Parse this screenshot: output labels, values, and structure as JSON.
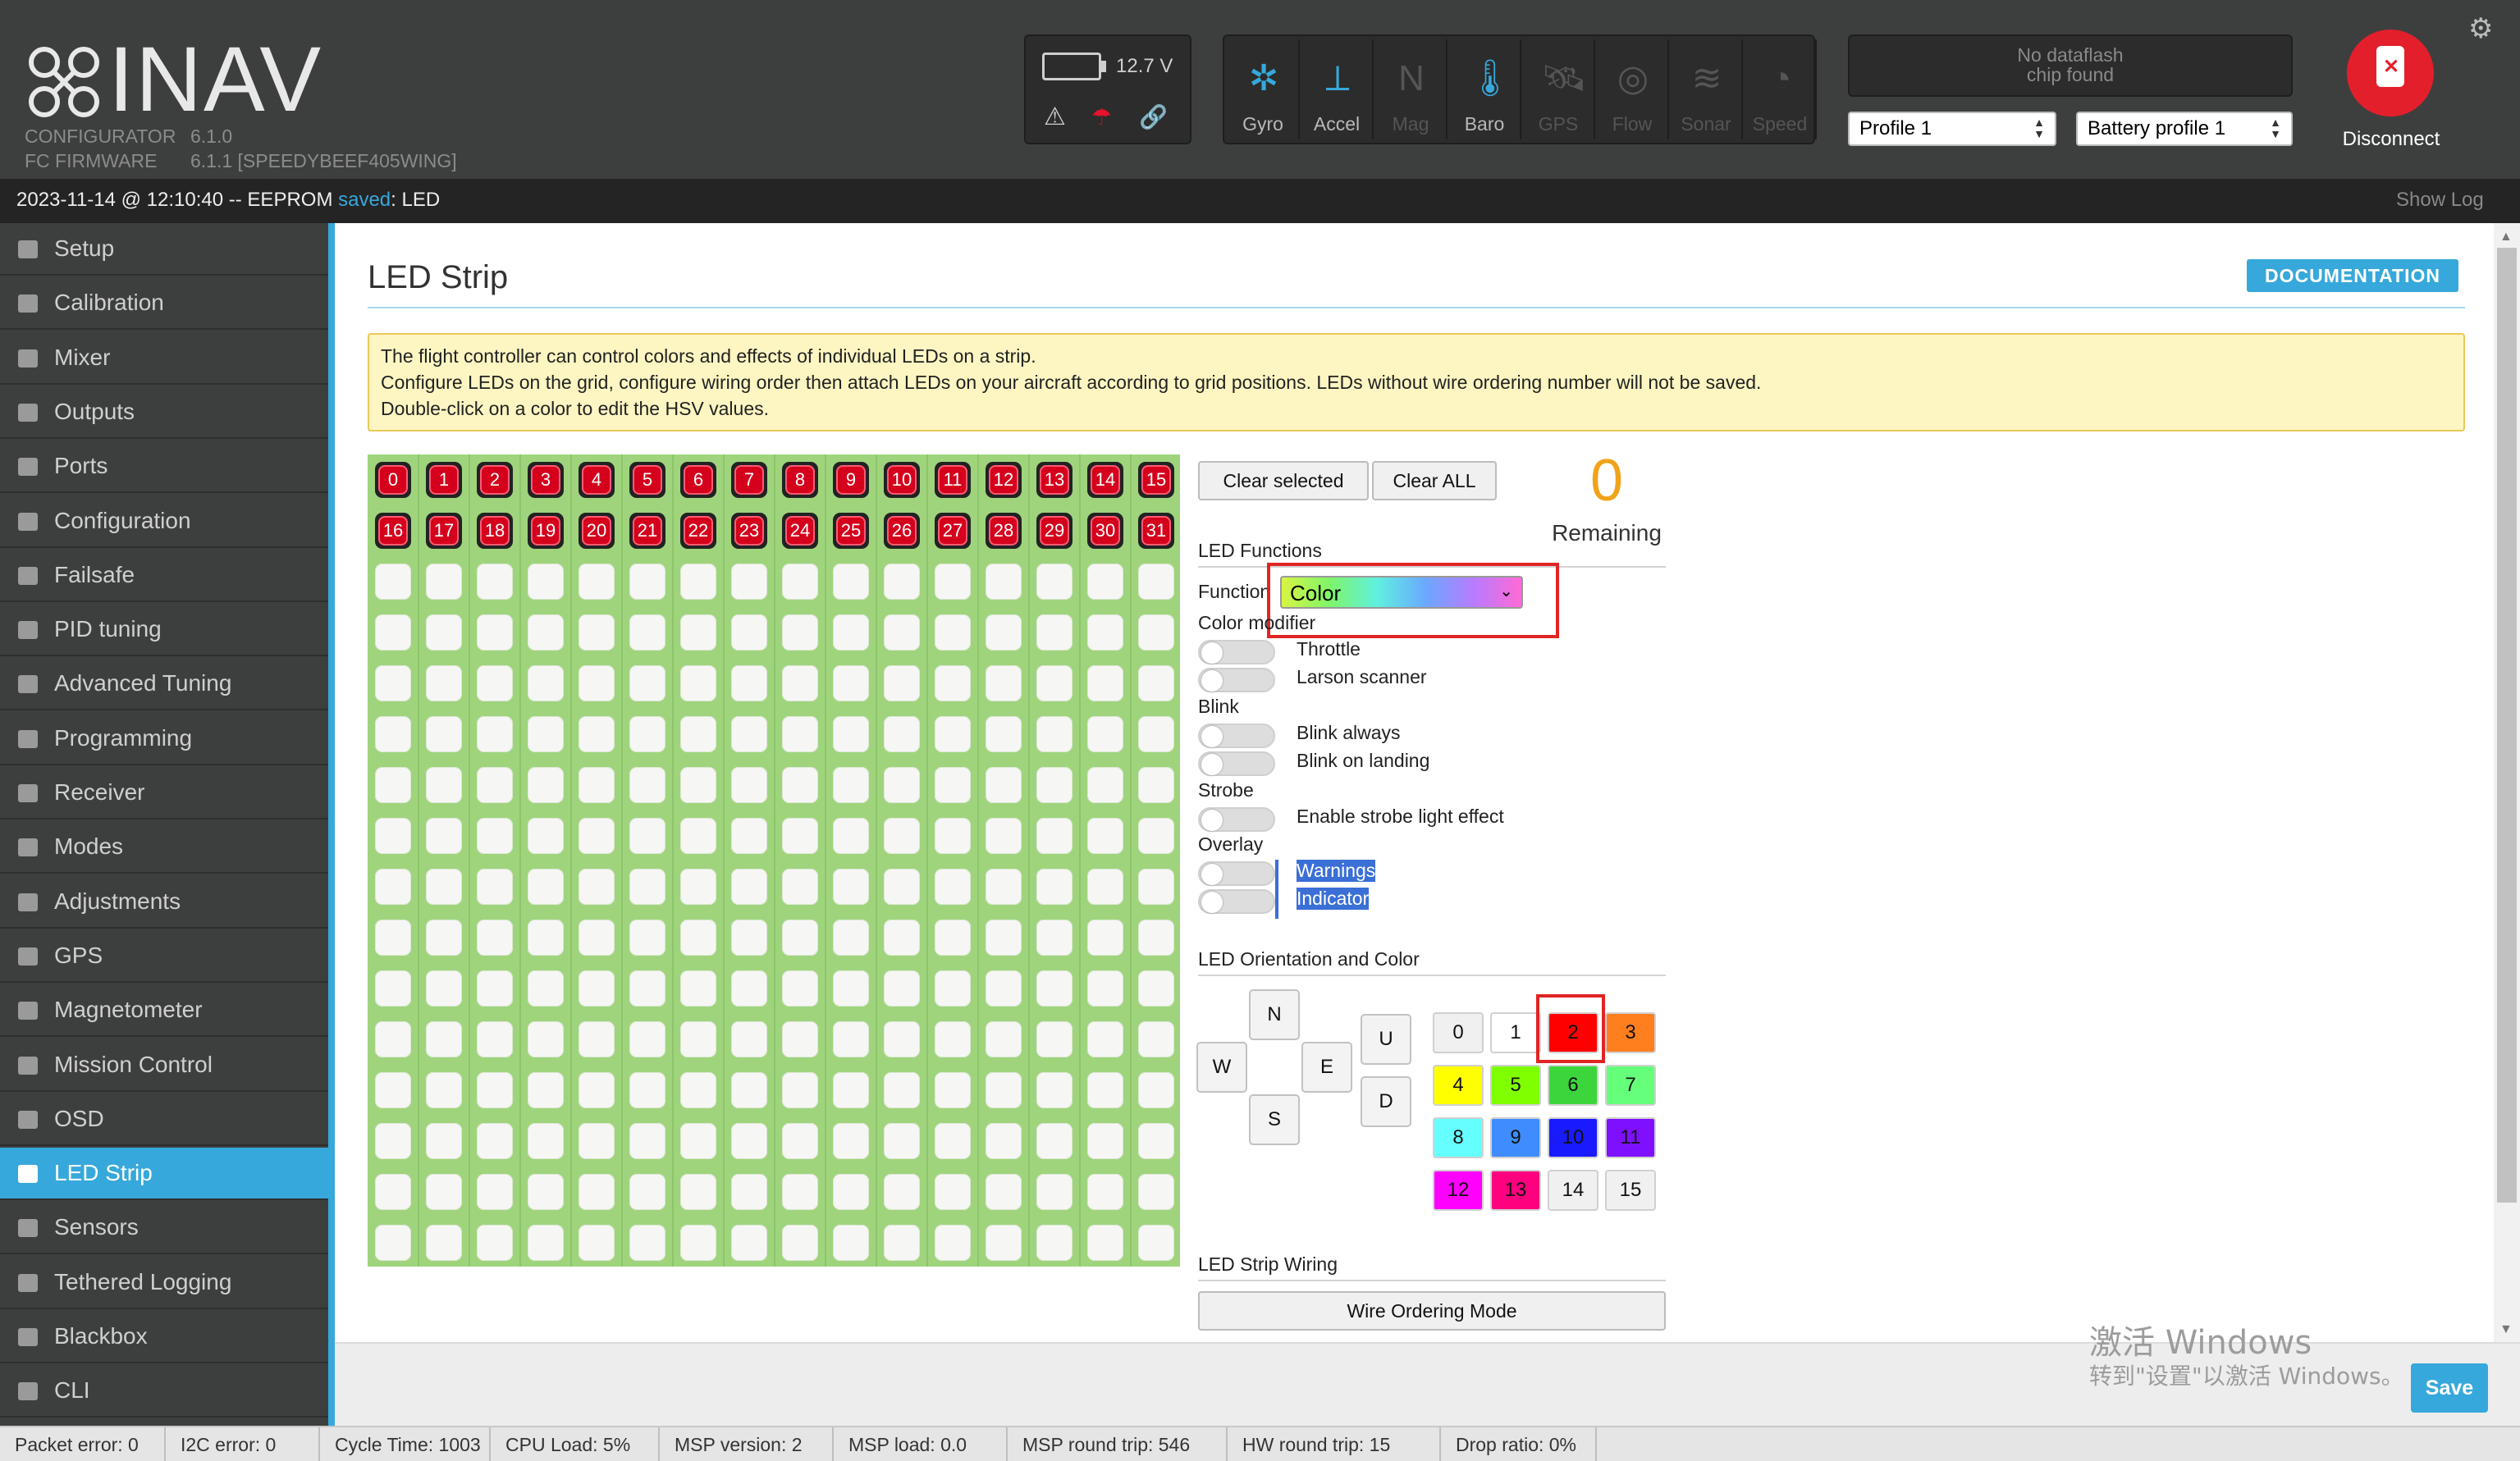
{
  "app": {
    "logo_text": "INAV",
    "configurator_label": "CONFIGURATOR",
    "configurator_version": "6.1.0",
    "fc_label": "FC FIRMWARE",
    "fc_version": "6.1.1 [SPEEDYBEEF405WING]"
  },
  "battery": {
    "voltage": "12.7 V"
  },
  "sensors": [
    {
      "label": "Gyro",
      "active": true,
      "icon": "gyro-icon"
    },
    {
      "label": "Accel",
      "active": true,
      "icon": "accel-icon"
    },
    {
      "label": "Mag",
      "active": false,
      "icon": "mag-icon"
    },
    {
      "label": "Baro",
      "active": true,
      "icon": "baro-icon"
    },
    {
      "label": "GPS",
      "active": false,
      "icon": "gps-icon"
    },
    {
      "label": "Flow",
      "active": false,
      "icon": "flow-icon"
    },
    {
      "label": "Sonar",
      "active": false,
      "icon": "sonar-icon"
    },
    {
      "label": "Speed",
      "active": false,
      "icon": "speed-icon"
    }
  ],
  "dataflash": {
    "line1": "No dataflash",
    "line2": "chip found"
  },
  "profile": {
    "selected": "Profile 1"
  },
  "battery_profile": {
    "selected": "Battery profile 1"
  },
  "disconnect": {
    "label": "Disconnect"
  },
  "statusbar": {
    "prefix": "2023-11-14 @ 12:10:40 -- EEPROM ",
    "saved": "saved",
    "suffix": ": LED",
    "show_log": "Show Log"
  },
  "sidebar": {
    "items": [
      {
        "label": "Setup",
        "icon": "wrench-icon"
      },
      {
        "label": "Calibration",
        "icon": "crosshair-icon"
      },
      {
        "label": "Mixer",
        "icon": "mixer-icon"
      },
      {
        "label": "Outputs",
        "icon": "motor-icon"
      },
      {
        "label": "Ports",
        "icon": "plug-icon"
      },
      {
        "label": "Configuration",
        "icon": "gear-icon"
      },
      {
        "label": "Failsafe",
        "icon": "parachute-icon"
      },
      {
        "label": "PID tuning",
        "icon": "pid-icon"
      },
      {
        "label": "Advanced Tuning",
        "icon": "tree-icon"
      },
      {
        "label": "Programming",
        "icon": "gear-icon"
      },
      {
        "label": "Receiver",
        "icon": "receiver-icon"
      },
      {
        "label": "Modes",
        "icon": "toggle-icon"
      },
      {
        "label": "Adjustments",
        "icon": "sliders-icon"
      },
      {
        "label": "GPS",
        "icon": "satellite-icon"
      },
      {
        "label": "Magnetometer",
        "icon": "compass-icon"
      },
      {
        "label": "Mission Control",
        "icon": "map-pin-icon"
      },
      {
        "label": "OSD",
        "icon": "osd-icon"
      },
      {
        "label": "LED Strip",
        "icon": "bulb-icon"
      },
      {
        "label": "Sensors",
        "icon": "pulse-icon"
      },
      {
        "label": "Tethered Logging",
        "icon": "log-icon"
      },
      {
        "label": "Blackbox",
        "icon": "blackbox-icon"
      },
      {
        "label": "CLI",
        "icon": "terminal-icon"
      }
    ],
    "active_index": 17
  },
  "page": {
    "title": "LED Strip",
    "doc_button": "DOCUMENTATION",
    "note_lines": [
      "The flight controller can control colors and effects of individual LEDs on a strip.",
      "Configure LEDs on the grid, configure wiring order then attach LEDs on your aircraft according to grid positions. LEDs without wire ordering number will not be saved.",
      "Double-click on a color to edit the HSV values."
    ]
  },
  "grid": {
    "columns": 16,
    "rows": 16,
    "numbered_leds": [
      "0",
      "1",
      "2",
      "3",
      "4",
      "5",
      "6",
      "7",
      "8",
      "9",
      "10",
      "11",
      "12",
      "13",
      "14",
      "15",
      "16",
      "17",
      "18",
      "19",
      "20",
      "21",
      "22",
      "23",
      "24",
      "25",
      "26",
      "27",
      "28",
      "29",
      "30",
      "31"
    ]
  },
  "controls": {
    "clear_selected": "Clear selected",
    "clear_all": "Clear ALL",
    "remaining_count": "0",
    "remaining_label": "Remaining",
    "led_functions_heading": "LED Functions",
    "function_label": "Function",
    "function_value": "Color",
    "color_modifier_heading": "Color modifier",
    "color_modifiers": [
      "Throttle",
      "Larson scanner"
    ],
    "blink_heading": "Blink",
    "blink_options": [
      "Blink always",
      "Blink on landing"
    ],
    "strobe_heading": "Strobe",
    "strobe_options": [
      "Enable strobe light effect"
    ],
    "overlay_heading": "Overlay",
    "overlay_options": [
      "Warnings",
      "Indicator"
    ],
    "orientation_heading": "LED Orientation and Color",
    "directions": {
      "n": "N",
      "w": "W",
      "e": "E",
      "s": "S",
      "u": "U",
      "d": "D"
    },
    "colors": [
      {
        "label": "0",
        "color": "#f0f0f0"
      },
      {
        "label": "1",
        "color": "#ffffff"
      },
      {
        "label": "2",
        "color": "#ff0000"
      },
      {
        "label": "3",
        "color": "#ff7f1f"
      },
      {
        "label": "4",
        "color": "#ffff00"
      },
      {
        "label": "5",
        "color": "#7fff00"
      },
      {
        "label": "6",
        "color": "#3cd63c"
      },
      {
        "label": "7",
        "color": "#66ff7a"
      },
      {
        "label": "8",
        "color": "#66ffff"
      },
      {
        "label": "9",
        "color": "#3f8cff"
      },
      {
        "label": "10",
        "color": "#1a1aff"
      },
      {
        "label": "11",
        "color": "#7f10ff"
      },
      {
        "label": "12",
        "color": "#ff00ff"
      },
      {
        "label": "13",
        "color": "#ff007f"
      },
      {
        "label": "14",
        "color": "#f0f0f0"
      },
      {
        "label": "15",
        "color": "#f0f0f0"
      }
    ],
    "selected_color": "2",
    "wiring_heading": "LED Strip Wiring",
    "wire_ordering_button": "Wire Ordering Mode"
  },
  "save_button": "Save",
  "watermark": {
    "line1": "激活 Windows",
    "line2": "转到\"设置\"以激活 Windows。"
  },
  "bottombar": [
    "Packet error: 0",
    "I2C error: 0",
    "Cycle Time: 1003",
    "CPU Load: 5%",
    "MSP version: 2",
    "MSP load: 0.0",
    "MSP round trip: 546",
    "HW round trip: 15",
    "Drop ratio: 0%"
  ]
}
